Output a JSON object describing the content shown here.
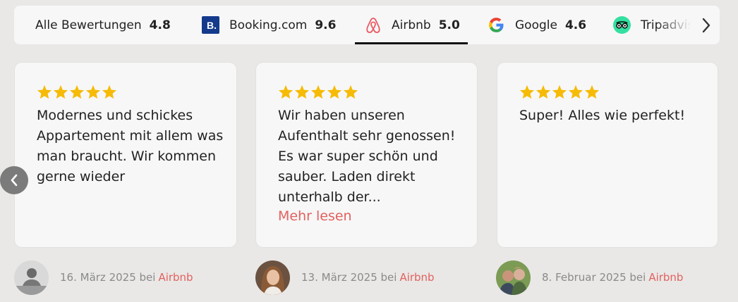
{
  "tabs": [
    {
      "label": "Alle Bewertungen",
      "score": "4.8",
      "icon": "none"
    },
    {
      "label": "Booking.com",
      "score": "9.6",
      "icon": "booking-logo"
    },
    {
      "label": "Airbnb",
      "score": "5.0",
      "icon": "airbnb-logo",
      "active": true
    },
    {
      "label": "Google",
      "score": "4.6",
      "icon": "google-logo"
    },
    {
      "label": "Tripadvisor",
      "score": "",
      "icon": "tripadvisor-logo"
    }
  ],
  "reviews": [
    {
      "stars": 5,
      "text": "Modernes und schickes Appartement mit allem was man braucht. Wir kommen gerne wieder",
      "date": "16. März 2025 bei",
      "source": "Airbnb"
    },
    {
      "stars": 5,
      "text": "Wir haben unseren Aufenthalt sehr genossen! Es war super schön und sauber. Laden direkt unterhalb der...",
      "more": "Mehr lesen",
      "date": "13. März 2025 bei",
      "source": "Airbnb"
    },
    {
      "stars": 5,
      "text": "Super! Alles wie perfekt!",
      "date": "8. Februar 2025 bei",
      "source": "Airbnb"
    }
  ],
  "colors": {
    "star": "#f6bb06",
    "link": "#e2615f",
    "active_underline": "#111111",
    "background": "#e9e8e6"
  }
}
